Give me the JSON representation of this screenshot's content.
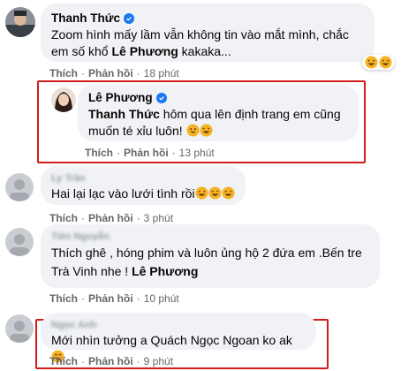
{
  "comments": [
    {
      "author": "Thanh Thức",
      "text_line1": "Zoom hình mấy lầm vẫn không tin vào mắt mình, chắc",
      "text_line2_prefix": "em số khổ ",
      "mention": "Lê Phương",
      "text_line2_suffix": " kakaka...",
      "like_label": "Thích",
      "reply_label": "Phản hồi",
      "time": "18 phút",
      "reaction": "laughing-emoji"
    },
    {
      "author": "Lê Phương",
      "mention": "Thanh Thức",
      "text_line1": " hôm qua lên định trang em cũng",
      "text_line2": "muốn té xỉu luôn!",
      "like_label": "Thích",
      "reply_label": "Phản hồi",
      "time": "13 phút",
      "emojis": [
        "grinning-sweat-emoji",
        "laughing-emoji"
      ]
    },
    {
      "author": "Ly Trần",
      "text": "Hai lại lạc vào lưới tình rồi",
      "like_label": "Thích",
      "reply_label": "Phản hồi",
      "time": "3 phút",
      "emojis": [
        "laughing-emoji",
        "laughing-emoji",
        "laughing-emoji"
      ]
    },
    {
      "author": "Tiên Nguyễn",
      "text_line1": "Thích ghê , hóng phim và luôn ủng hộ 2 đứa em .Bến tre",
      "text_line2_prefix": "Trà Vinh nhe ! ",
      "mention": "Lê Phương",
      "like_label": "Thích",
      "reply_label": "Phản hồi",
      "time": "10 phút"
    },
    {
      "author": "Ngọc Anh",
      "text": "Mới nhìn tưởng a Quách Ngọc Ngoan ko ak",
      "like_label": "Thích",
      "reply_label": "Phản hồi",
      "time": "9 phút",
      "emojis": [
        "smiling-emoji"
      ]
    }
  ],
  "colors": {
    "bubble": "#f0f2f5",
    "muted": "#65676b",
    "highlight_box": "#d11c1c",
    "verified": "#1877f2"
  }
}
